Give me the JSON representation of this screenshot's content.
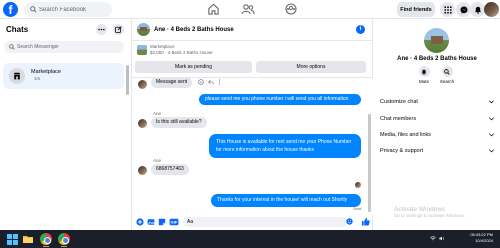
{
  "topbar": {
    "logo": "f",
    "search_placeholder": "Search Facebook",
    "find_friends": "Find friends"
  },
  "sidebar": {
    "title": "Chats",
    "search_placeholder": "Search Messenger",
    "chats": [
      {
        "name": "Marketplace",
        "time": "1m"
      }
    ]
  },
  "conversation": {
    "title": "Ane · 4 Beds 2 Baths House",
    "listing": {
      "kicker": "Marketplace",
      "price_line": "$2,050 · 4 Beds 2 Baths House",
      "mark_pending": "Mark as pending",
      "more_options": "More options"
    },
    "messages": [
      {
        "from": "them",
        "text": "Message sent"
      },
      {
        "from": "me",
        "text": "please send me you phone number i will send you all information"
      },
      {
        "from": "them",
        "sender": "Ane",
        "text": "Is this still available?"
      },
      {
        "from": "me",
        "text": "This  House is available for rent send me your Phone Number for more information about the house  thanks"
      },
      {
        "from": "them",
        "sender": "Ane",
        "text": "6868757463"
      },
      {
        "from": "me",
        "text": "Thanks for your interest in the house! will reach out Shortly"
      }
    ],
    "sent_status": "Sent",
    "composer_value": "Aa"
  },
  "info_panel": {
    "name": "Ane · 4 Beds 2 Baths House",
    "actions": [
      {
        "label": "Mute",
        "icon": "bell-icon"
      },
      {
        "label": "Search",
        "icon": "search-icon"
      }
    ],
    "rows": [
      "Customize chat",
      "Chat members",
      "Media, files and links",
      "Privacy & support"
    ]
  },
  "watermark": {
    "line1": "Activate Windows",
    "line2": "Go to Settings to activate Windows."
  },
  "taskbar": {
    "time": "05:43:22 PM",
    "date": "10/4/2024"
  },
  "colors": {
    "brand_blue": "#0866ff",
    "outgoing_bubble": "#0084ff",
    "incoming_bubble": "#e4e6eb",
    "selected_chat": "#ebf3ff"
  }
}
